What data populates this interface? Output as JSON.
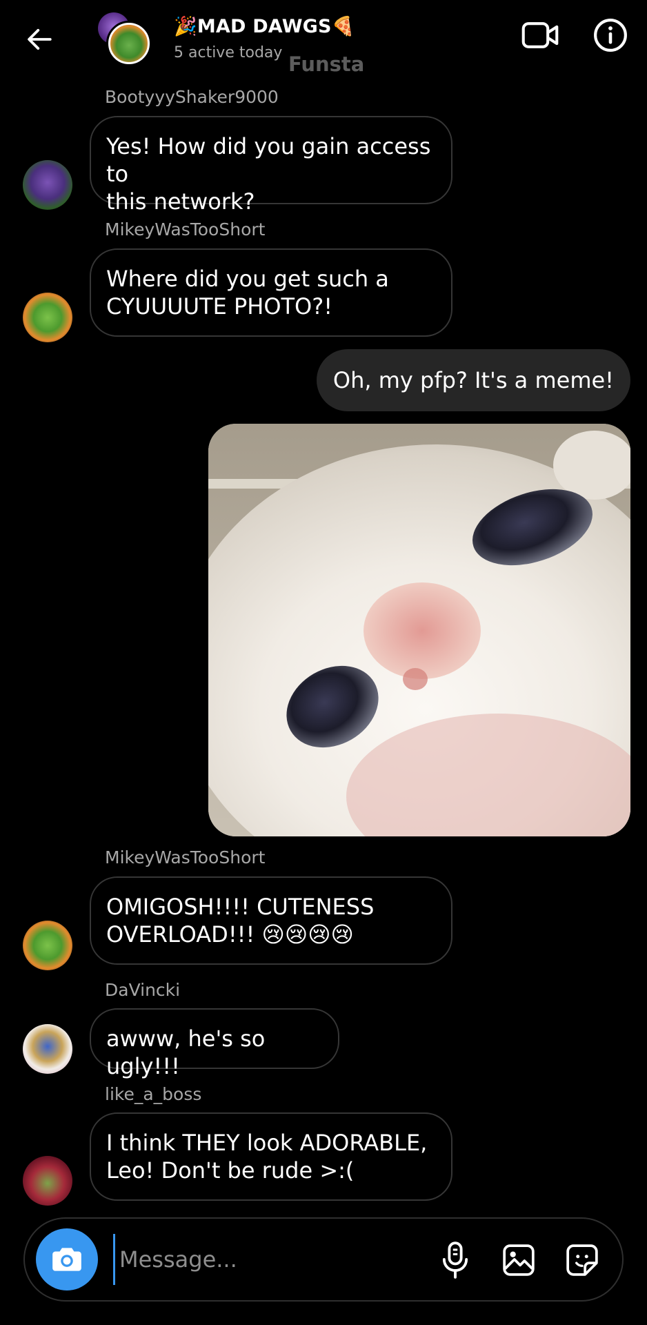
{
  "header": {
    "title": "🎉MAD DAWGS🍕",
    "status": "5 active today",
    "watermark": "Funsta"
  },
  "icons": {
    "back": "arrow-left-icon",
    "video": "video-camera-icon",
    "info": "info-circle-icon",
    "camera": "camera-icon",
    "mic": "microphone-icon",
    "gallery": "image-icon",
    "sticker": "sticker-icon"
  },
  "messages": [
    {
      "sender": "BootyyyShaker9000",
      "text": "Yes! How did you gain access to\nthis network?"
    },
    {
      "sender": "MikeyWasTooShort",
      "text": "Where did you get such a\nCYUUUUTE PHOTO?!"
    },
    {
      "text": "Oh, my pfp? It's a meme!"
    },
    {
      "sender": "MikeyWasTooShort",
      "text": "OMIGOSH!!!! CUTENESS\nOVERLOAD!!! 😢😢😢😢"
    },
    {
      "sender": "DaVincki",
      "text": "awww, he's so ugly!!!"
    },
    {
      "sender": "like_a_boss",
      "text": "I think THEY look ADORABLE,\nLeo! Don't be rude >:("
    }
  ],
  "composer": {
    "placeholder": "Message..."
  },
  "colors": {
    "background": "#000000",
    "outgoing_bubble": "#262626",
    "incoming_border": "#363636",
    "accent": "#3897f0",
    "muted_text": "#a8a8a8"
  }
}
